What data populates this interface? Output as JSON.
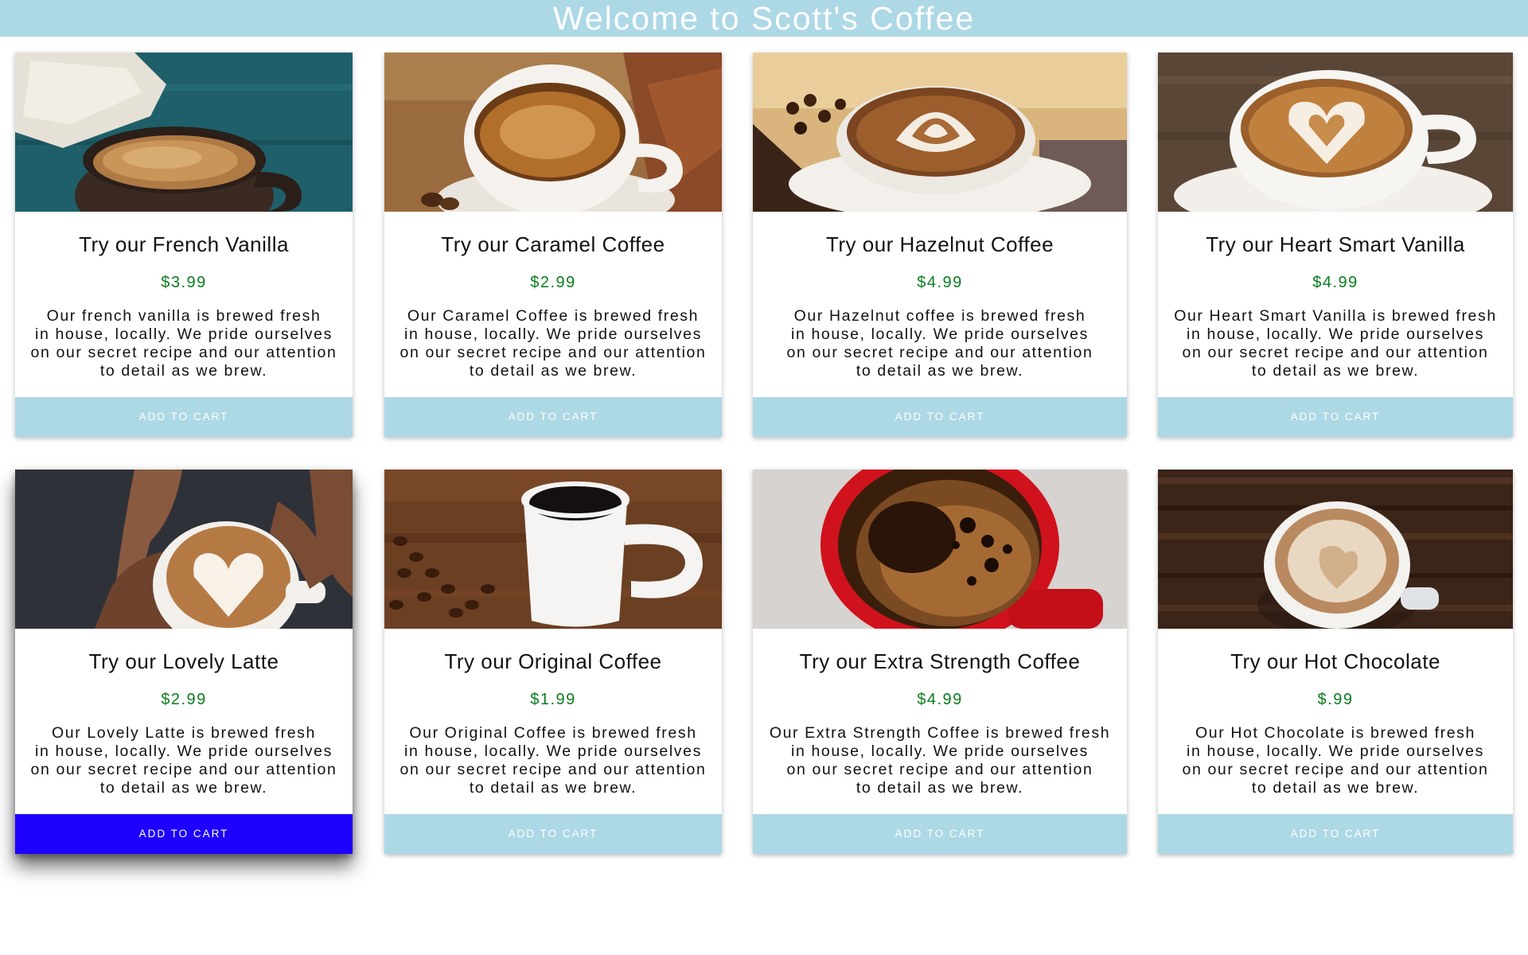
{
  "header": {
    "title": "Welcome to Scott's Coffee"
  },
  "colors": {
    "header_bg": "#add8e6",
    "button_bg": "#add8e6",
    "button_active_bg": "#1e00ff",
    "price_text": "#0b7d1f"
  },
  "products": [
    {
      "title": "Try our French Vanilla",
      "price": "$3.99",
      "description": [
        "Our french vanilla is brewed fresh",
        "in house, locally. We pride ourselves",
        "on our secret recipe and our attention",
        "to detail as we brew."
      ],
      "button_label": "ADD TO CART",
      "button_active": false,
      "image": "coffee cup on teal wooden table with cloth napkin"
    },
    {
      "title": "Try our Caramel Coffee",
      "price": "$2.99",
      "description": [
        "Our Caramel Coffee is brewed fresh",
        "in house, locally. We pride ourselves",
        "on our secret recipe and our attention",
        "to detail as we brew."
      ],
      "button_label": "ADD TO CART",
      "button_active": false,
      "image": "steaming coffee cup on wooden table"
    },
    {
      "title": "Try our Hazelnut Coffee",
      "price": "$4.99",
      "description": [
        "Our Hazelnut coffee is brewed fresh",
        "in house, locally. We pride ourselves",
        "on our secret recipe and our attention",
        "to detail as we brew."
      ],
      "button_label": "ADD TO CART",
      "button_active": false,
      "image": "latte art cup with coffee beans and cinnamon"
    },
    {
      "title": "Try our Heart Smart Vanilla",
      "price": "$4.99",
      "description": [
        "Our Heart Smart Vanilla is brewed fresh",
        "in house, locally. We pride ourselves",
        "on our secret recipe and our attention",
        "to detail as we brew."
      ],
      "button_label": "ADD TO CART",
      "button_active": false,
      "image": "heart latte art cup on wooden table"
    },
    {
      "title": "Try our Lovely Latte",
      "price": "$2.99",
      "description": [
        "Our Lovely Latte is brewed fresh",
        "in house, locally. We pride ourselves",
        "on our secret recipe and our attention",
        "to detail as we brew."
      ],
      "button_label": "ADD TO CART",
      "button_active": true,
      "image": "hands holding heart latte cup"
    },
    {
      "title": "Try our Original Coffee",
      "price": "$1.99",
      "description": [
        "Our Original Coffee is brewed fresh",
        "in house, locally. We pride ourselves",
        "on our secret recipe and our attention",
        "to detail as we brew."
      ],
      "button_label": "ADD TO CART",
      "button_active": false,
      "image": "white mug of black coffee with coffee beans"
    },
    {
      "title": "Try our Extra Strength Coffee",
      "price": "$4.99",
      "description": [
        "Our Extra Strength Coffee is brewed fresh",
        "in house, locally. We pride ourselves",
        "on our secret recipe and our attention",
        "to detail as we brew."
      ],
      "button_label": "ADD TO CART",
      "button_active": false,
      "image": "red mug of strong coffee top view"
    },
    {
      "title": "Try our Hot Chocolate",
      "price": "$.99",
      "description": [
        "Our Hot Chocolate is brewed fresh",
        "in house, locally. We pride ourselves",
        "on our secret recipe and our attention",
        "to detail as we brew."
      ],
      "button_label": "ADD TO CART",
      "button_active": false,
      "image": "latte cup on dark wooden table"
    }
  ]
}
